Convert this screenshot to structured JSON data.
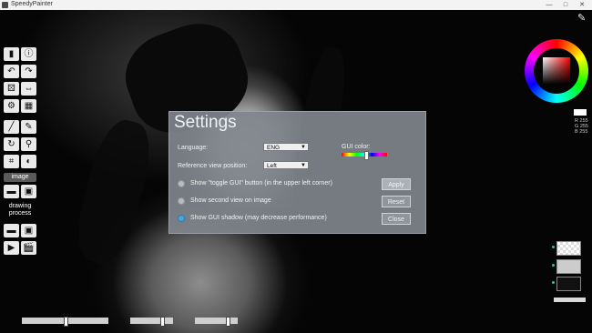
{
  "window": {
    "title": "SpeedyPainter",
    "minimize": "—",
    "maximize": "□",
    "close": "✕"
  },
  "toolbar": {
    "section_image": "image",
    "section_drawing_process": "drawing process",
    "icons": [
      "new-document-icon",
      "info-icon",
      "undo-icon",
      "redo-icon",
      "random-icon",
      "resize-icon",
      "settings-icon",
      "layout-icon",
      "brush-icon",
      "pencil-icon",
      "rotate-icon",
      "eyedropper-icon",
      "crop-icon",
      "contrast-icon"
    ]
  },
  "dialog": {
    "title": "Settings",
    "language_label": "Language:",
    "language_value": "ENG",
    "reference_label": "Reference view position:",
    "reference_value": "Left",
    "gui_color_label": "GUI color:",
    "option_toggle_gui": "Show \"toggle GUI\" button (in the upper left corner)",
    "option_second_view": "Show second view on image",
    "option_gui_shadow": "Show GUI shadow (may decrease performance)",
    "apply_label": "Apply",
    "reset_label": "Reset",
    "close_label": "Close"
  },
  "color": {
    "r": "255",
    "g": "255",
    "b": "255",
    "r_label": "R",
    "g_label": "G",
    "b_label": "B"
  },
  "colors": {
    "dialog_bg": "#80868c",
    "accent_radio": "#48a7e0",
    "layer_indicator": "#2ecc71"
  }
}
